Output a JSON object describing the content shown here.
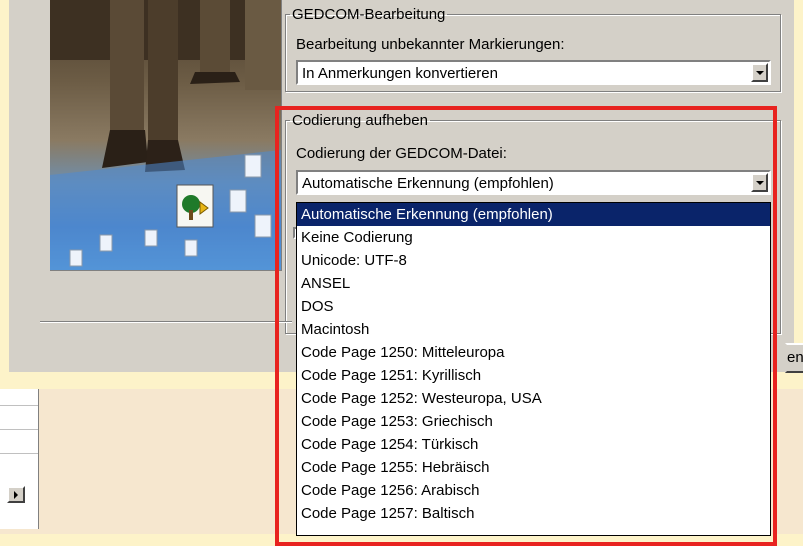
{
  "gedcom_group": {
    "title": "GEDCOM-Bearbeitung",
    "unknown_tags_label": "Bearbeitung unbekannter Markierungen:",
    "unknown_tags_value": "In Anmerkungen konvertieren"
  },
  "encoding_group": {
    "title": "Codierung aufheben",
    "file_encoding_label": "Codierung der GEDCOM-Datei:",
    "file_encoding_value": "Automatische Erkennung (empfohlen)"
  },
  "dropdown": {
    "options": [
      "Automatische Erkennung (empfohlen)",
      "Keine Codierung",
      "Unicode: UTF-8",
      "ANSEL",
      "DOS",
      "Macintosh",
      "Code Page 1250: Mitteleuropa",
      "Code Page 1251: Kyrillisch",
      "Code Page 1252: Westeuropa, USA",
      "Code Page 1253: Griechisch",
      "Code Page 1254: Türkisch",
      "Code Page 1255: Hebräisch",
      "Code Page 1256: Arabisch",
      "Code Page 1257: Baltisch"
    ],
    "selected_index": 0
  },
  "partial_button_label": "en",
  "colors": {
    "highlight_border": "#e8231f",
    "selection": "#0a246a",
    "dialog_bg": "#d4d0c8",
    "page_bg": "#fdf3c9"
  }
}
